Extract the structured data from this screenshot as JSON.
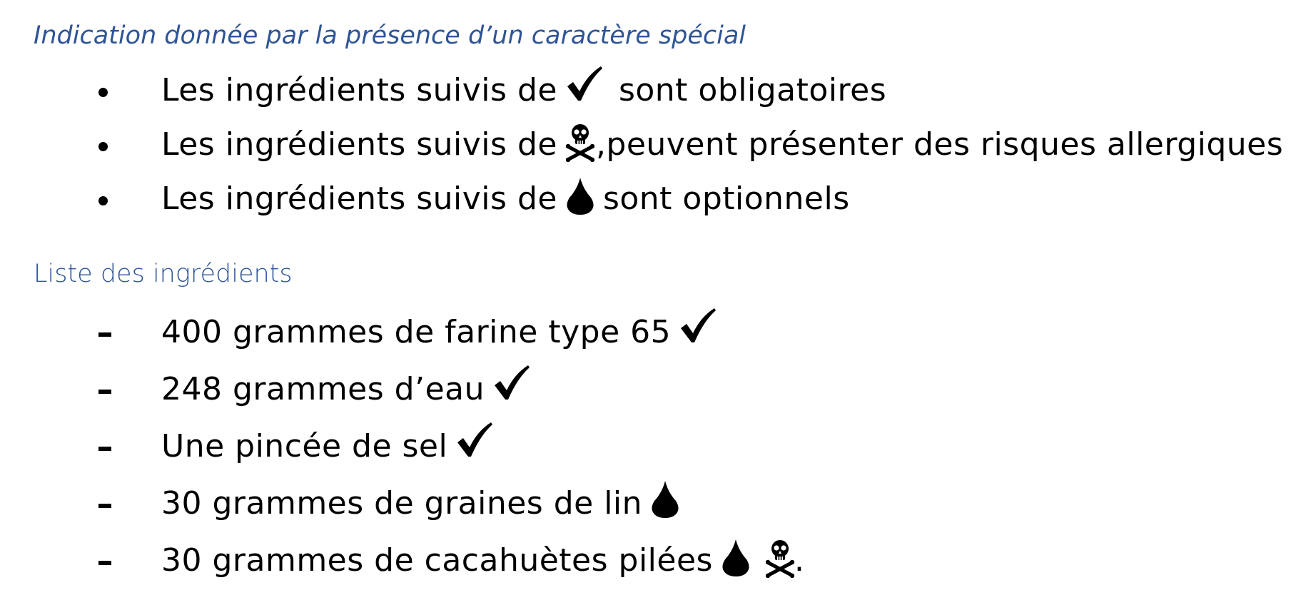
{
  "legend_heading": "Indication donnée par la présence d’un caractère spécial",
  "legend_items": [
    {
      "text": "Les ingrédients suivis de",
      "icon": "checkmark-icon",
      "after": "sont obligatoires"
    },
    {
      "text": "Les ingrédients suivis de",
      "icon": "skull-crossbones-icon",
      "after": ",peuvent présenter des risques allergiques"
    },
    {
      "text": "Les ingrédients suivis de",
      "icon": "droplet-icon",
      "after": "sont optionnels"
    }
  ],
  "ingredients_heading": "Liste des ingrédients",
  "ingredients": [
    {
      "text": "400 grammes de farine type 65",
      "icons": [
        "checkmark-icon"
      ]
    },
    {
      "text": "248 grammes d’eau",
      "icons": [
        "checkmark-icon"
      ]
    },
    {
      "text": "Une pincée de sel",
      "icons": [
        "checkmark-icon"
      ]
    },
    {
      "text": "30 grammes de graines de lin",
      "icons": [
        "droplet-icon"
      ]
    },
    {
      "text": "30 grammes de cacahuètes pilées",
      "icons": [
        "droplet-icon",
        "skull-crossbones-icon"
      ],
      "after": "."
    }
  ],
  "colors": {
    "heading": "#2F5597",
    "text": "#000000"
  }
}
